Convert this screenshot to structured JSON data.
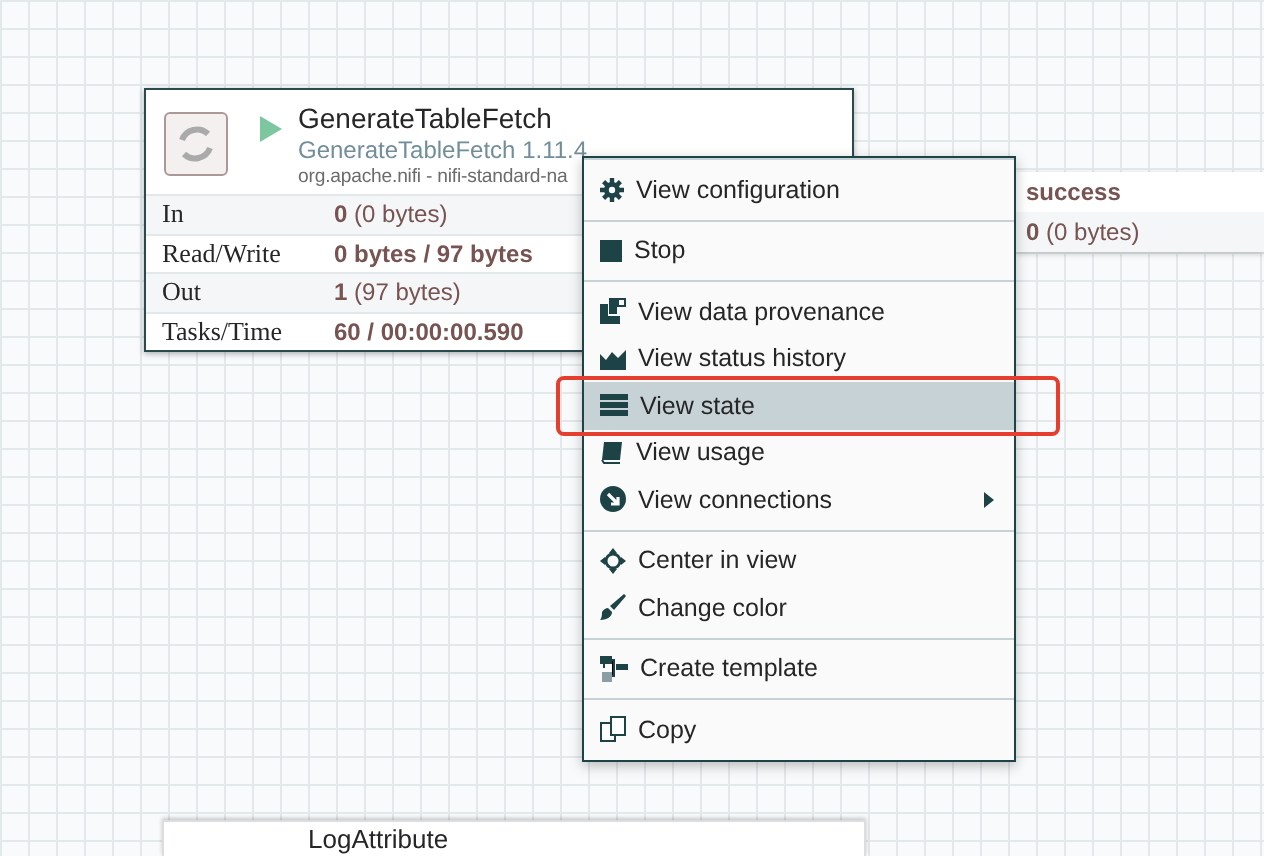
{
  "processor": {
    "name": "GenerateTableFetch",
    "type": "GenerateTableFetch 1.11.4",
    "bundle": "org.apache.nifi - nifi-standard-na",
    "running": true,
    "stats": [
      {
        "label": "In",
        "count": "0",
        "detail": "(0 bytes)"
      },
      {
        "label": "Read/Write",
        "count": "0 bytes / 97 bytes"
      },
      {
        "label": "Out",
        "count": "1",
        "detail": "(97 bytes)"
      },
      {
        "label": "Tasks/Time",
        "count": "60 / 00:00:00.590"
      }
    ]
  },
  "connection": {
    "name": "success",
    "queued_count": "0",
    "queued_detail": "(0 bytes)"
  },
  "context_menu": {
    "groups": [
      [
        {
          "label": "View configuration",
          "selected": false,
          "submenu": false
        }
      ],
      [
        {
          "label": "Stop",
          "selected": false,
          "submenu": false
        }
      ],
      [
        {
          "label": "View data provenance",
          "selected": false,
          "submenu": false
        },
        {
          "label": "View status history",
          "selected": false,
          "submenu": false
        },
        {
          "label": "View state",
          "selected": true,
          "submenu": false
        },
        {
          "label": "View usage",
          "selected": false,
          "submenu": false
        },
        {
          "label": "View connections",
          "selected": false,
          "submenu": true
        }
      ],
      [
        {
          "label": "Center in view",
          "selected": false,
          "submenu": false
        },
        {
          "label": "Change color",
          "selected": false,
          "submenu": false
        }
      ],
      [
        {
          "label": "Create template",
          "selected": false,
          "submenu": false
        }
      ],
      [
        {
          "label": "Copy",
          "selected": false,
          "submenu": false
        }
      ]
    ]
  },
  "second_processor": {
    "name": "LogAttribute"
  }
}
